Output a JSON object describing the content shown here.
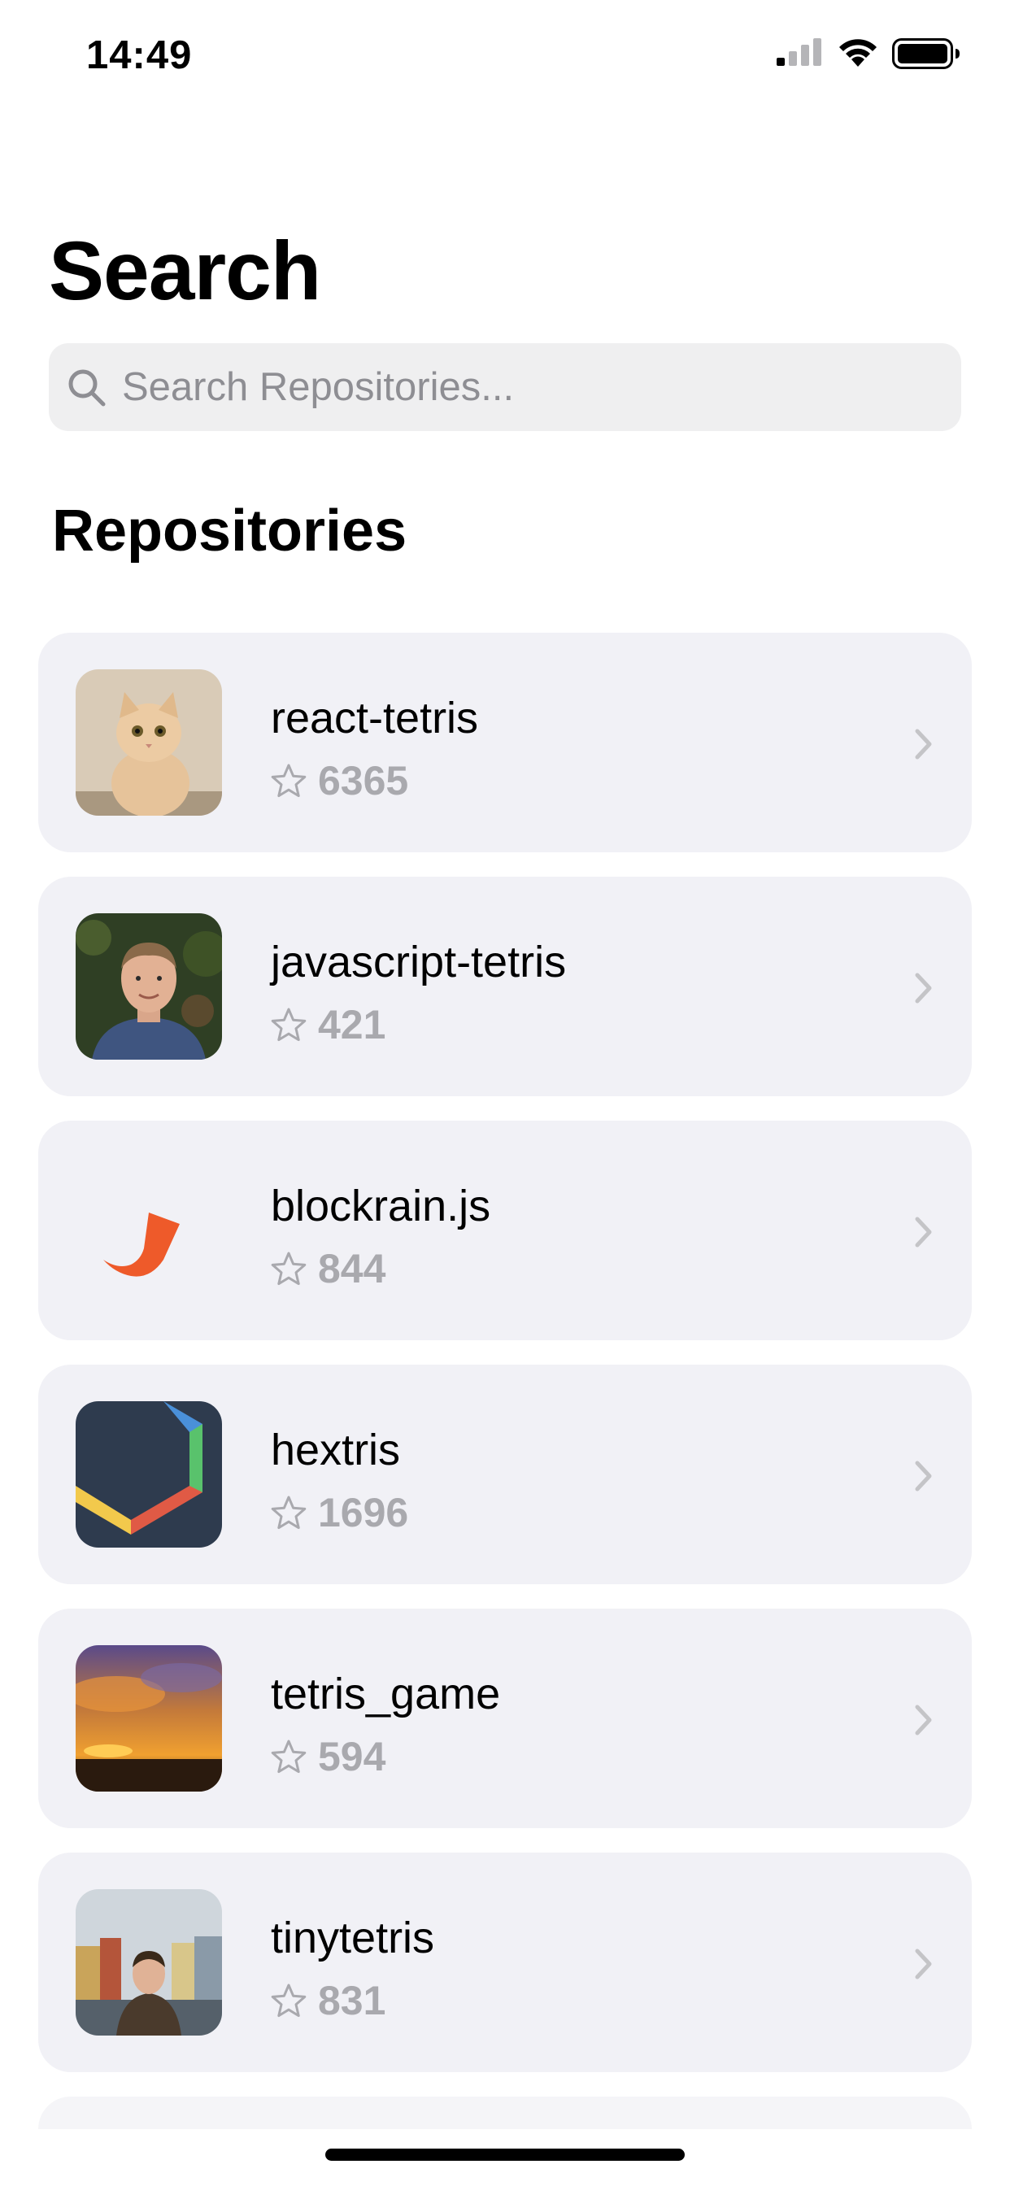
{
  "status_bar": {
    "time": "14:49"
  },
  "page": {
    "title": "Search",
    "section_heading": "Repositories"
  },
  "search": {
    "placeholder": "Search Repositories..."
  },
  "repositories": [
    {
      "name": "react-tetris",
      "stars": "6365",
      "avatar": "cat-photo"
    },
    {
      "name": "javascript-tetris",
      "stars": "421",
      "avatar": "person-photo"
    },
    {
      "name": "blockrain.js",
      "stars": "844",
      "avatar": "orange-logo"
    },
    {
      "name": "hextris",
      "stars": "1696",
      "avatar": "hexagon-logo"
    },
    {
      "name": "tetris_game",
      "stars": "594",
      "avatar": "sunset-photo"
    },
    {
      "name": "tinytetris",
      "stars": "831",
      "avatar": "city-person-photo"
    }
  ],
  "icons": {
    "search": "search-icon",
    "star": "star-icon",
    "chevron": "chevron-right-icon"
  },
  "colors": {
    "card_background": "#f1f1f6",
    "search_background": "#efeff0",
    "secondary_text": "#a9a9ae",
    "accent_orange": "#ee5a2a"
  }
}
